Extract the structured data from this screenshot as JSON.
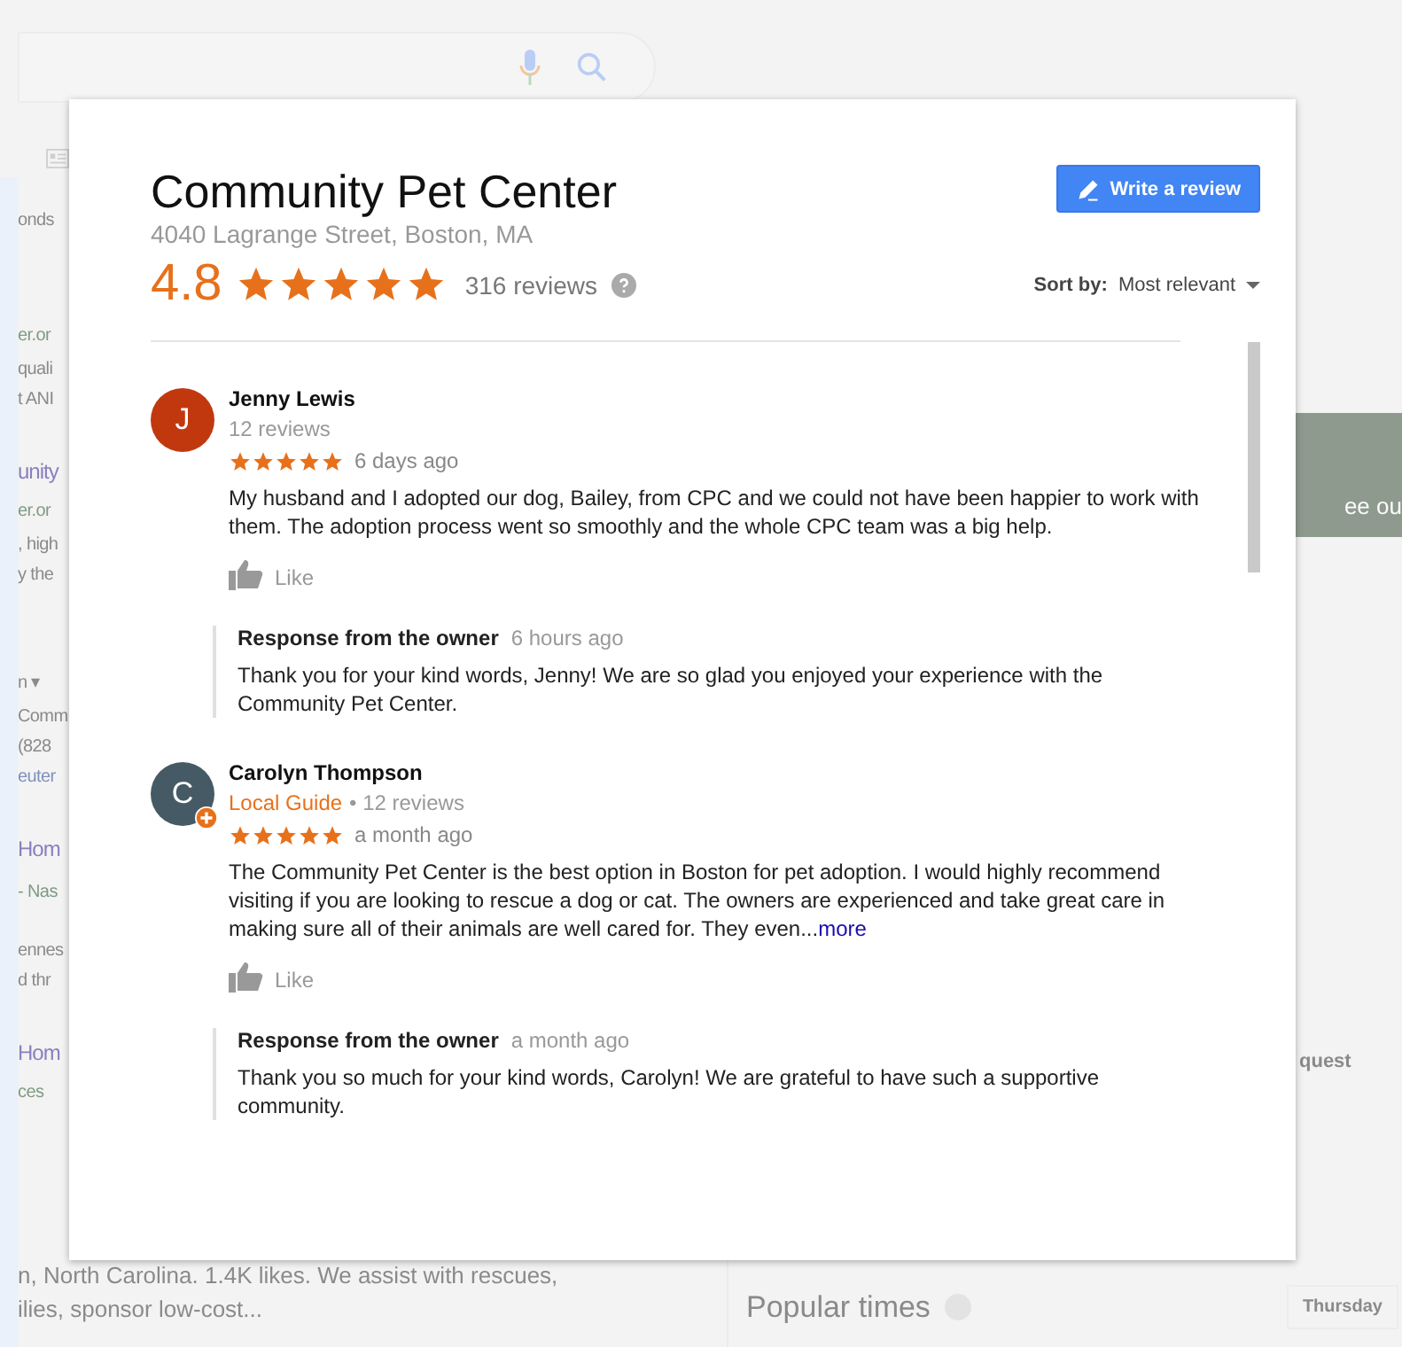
{
  "background": {
    "left_fragments": [
      {
        "text": "onds",
        "kind": "plain"
      },
      {
        "text": "er.or",
        "kind": "url"
      },
      {
        "text": "quali",
        "kind": "plain"
      },
      {
        "text": "t ANI",
        "kind": "plain"
      },
      {
        "text": "unity",
        "kind": "title"
      },
      {
        "text": "er.or",
        "kind": "url"
      },
      {
        "text": ", high",
        "kind": "plain"
      },
      {
        "text": "y the",
        "kind": "plain"
      },
      {
        "text": "n ▾",
        "kind": "plain"
      },
      {
        "text": "Comm",
        "kind": "plain"
      },
      {
        "text": "(828",
        "kind": "plain"
      },
      {
        "text": "euter",
        "kind": "link"
      },
      {
        "text": "Hom",
        "kind": "title"
      },
      {
        "text": "- Nas",
        "kind": "url"
      },
      {
        "text": "ennes",
        "kind": "plain"
      },
      {
        "text": "d thr",
        "kind": "plain"
      },
      {
        "text": "Hom",
        "kind": "title"
      },
      {
        "text": "ces",
        "kind": "url"
      }
    ],
    "right_fragments": [
      "ee ou",
      "quest"
    ],
    "bottom_lines": [
      "n, North Carolina. 1.4K likes. We assist with rescues,",
      "ilies, sponsor low-cost..."
    ],
    "popular_times": "Popular times",
    "day_button": "Thursday"
  },
  "dialog": {
    "title": "Community Pet Center",
    "address": "4040 Lagrange Street, Boston, MA",
    "rating": "4.8",
    "stars": 5,
    "review_count": "316 reviews",
    "write_button": "Write a review",
    "sort_label": "Sort by:",
    "sort_value": "Most relevant"
  },
  "reviews": [
    {
      "avatar_letter": "J",
      "color": "#c1380f",
      "author": "Jenny Lewis",
      "author_reviews": "12 reviews",
      "stars": 5,
      "time": "6 days ago",
      "text": "My husband and I adopted our dog, Bailey, from CPC and we could not have been happier to work with them. The adoption process went so smoothly and the whole CPC team was a big help.",
      "like": "Like",
      "response_title": "Response from the owner",
      "response_time": "6 hours ago",
      "response_text": "Thank you for your kind words, Jenny! We are so glad you enjoyed your experience with the Community Pet Center."
    },
    {
      "avatar_letter": "C",
      "color": "#455a64",
      "guide_label": "Local Guide",
      "author": "Carolyn Thompson",
      "author_reviews": "• 12 reviews",
      "stars": 5,
      "time": "a month ago",
      "text": "The Community Pet Center is the best option in Boston for pet adoption. I would highly recommend visiting if you are looking to rescue a dog or cat. The owners are experienced and take great care in making sure all of their animals are well cared for. They even...",
      "more": "more",
      "like": "Like",
      "response_title": "Response from the owner",
      "response_time": "a month ago",
      "response_text": "Thank you so much for your kind words, Carolyn! We are grateful to have such a supportive community."
    }
  ]
}
